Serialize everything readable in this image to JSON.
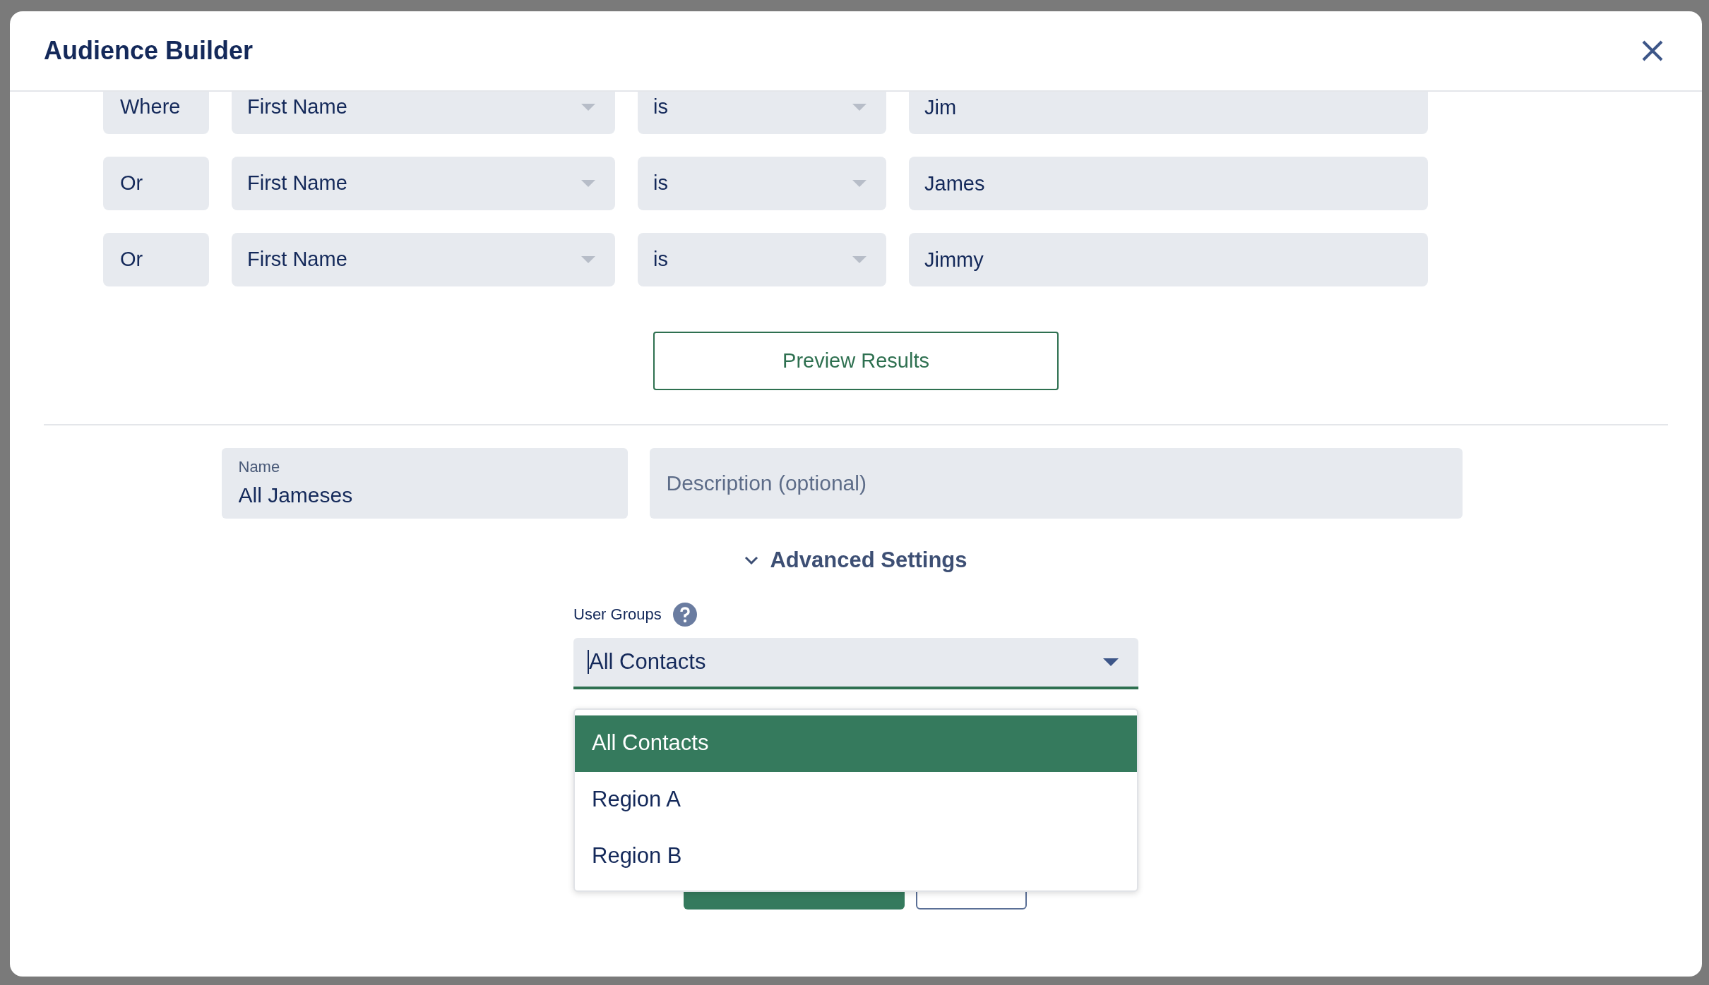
{
  "dialog": {
    "title": "Audience Builder"
  },
  "rules": [
    {
      "conjunction": "Where",
      "field": "First Name",
      "operator": "is",
      "value": "Jim"
    },
    {
      "conjunction": "Or",
      "field": "First Name",
      "operator": "is",
      "value": "James"
    },
    {
      "conjunction": "Or",
      "field": "First Name",
      "operator": "is",
      "value": "Jimmy"
    }
  ],
  "preview_button": "Preview Results",
  "name_field": {
    "label": "Name",
    "value": "All Jameses"
  },
  "description_field": {
    "placeholder": "Description (optional)"
  },
  "advanced_settings": {
    "label": "Advanced Settings",
    "expanded": true
  },
  "user_groups": {
    "label": "User Groups",
    "value": "All Contacts",
    "open": true,
    "options": [
      {
        "label": "All Contacts",
        "selected": true
      },
      {
        "label": "Region A",
        "selected": false
      },
      {
        "label": "Region B",
        "selected": false
      }
    ]
  }
}
